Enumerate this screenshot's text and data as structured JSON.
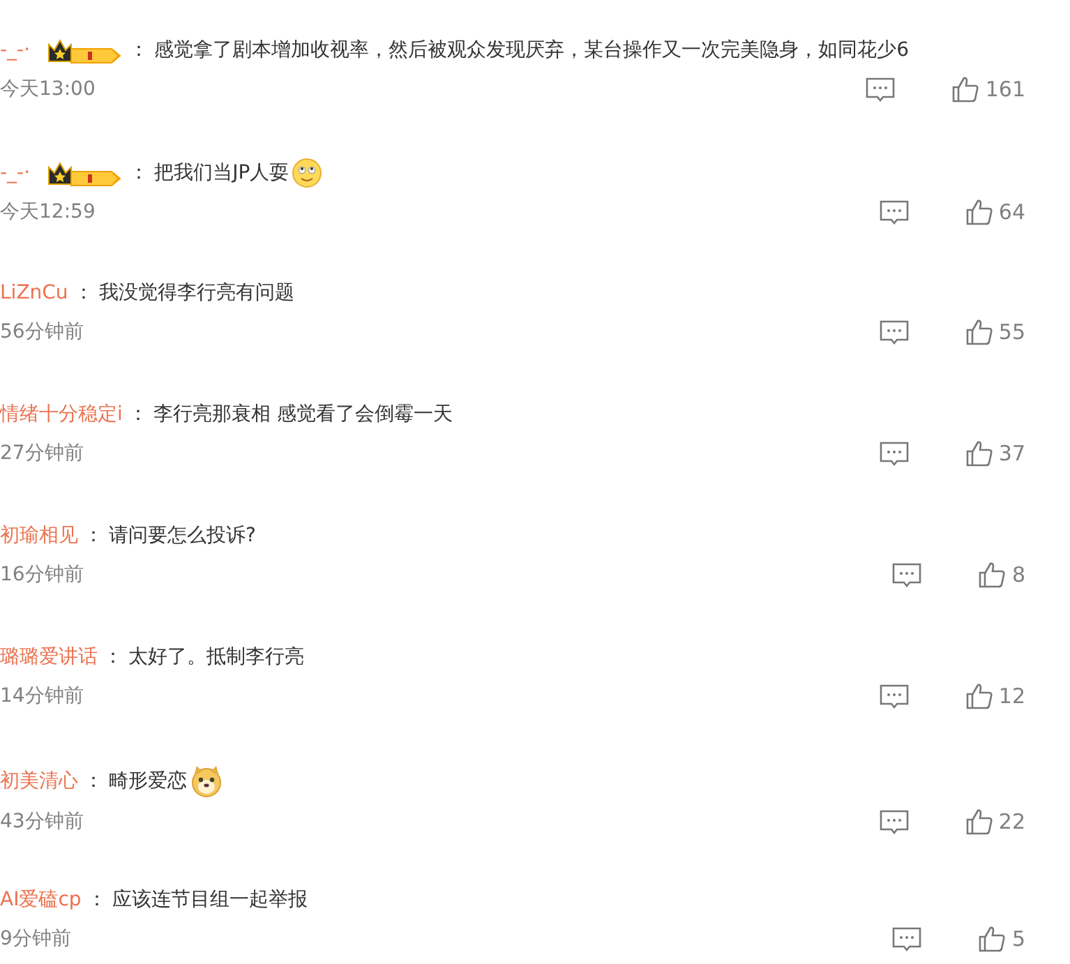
{
  "comments": [
    {
      "user": "-_-·",
      "vip_badge": true,
      "separator": "：",
      "text": "感觉拿了剧本增加收视率，然后被观众发现厌弃，某台操作又一次完美隐身，如同花少6",
      "time": "今天13:00",
      "likes": "161"
    },
    {
      "user": "-_-·",
      "vip_badge": true,
      "separator": "：",
      "text": "把我们当JP人耍",
      "emoji": {
        "kind": "face"
      },
      "time": "今天12:59",
      "likes": "64"
    },
    {
      "user": "LiZnCu",
      "vip_badge": false,
      "separator": "：",
      "text": "我没觉得李行亮有问题",
      "time": "56分钟前",
      "likes": "55"
    },
    {
      "user": "情绪十分稳定i",
      "vip_badge": false,
      "separator": "：",
      "text": "李行亮那衰相 感觉看了会倒霉一天",
      "time": "27分钟前",
      "likes": "37"
    },
    {
      "user": "初瑜相见",
      "vip_badge": false,
      "separator": "：",
      "text": "请问要怎么投诉?",
      "time": "16分钟前",
      "likes": "8"
    },
    {
      "user": "璐璐爱讲话",
      "vip_badge": false,
      "separator": "：",
      "text": "太好了。抵制李行亮",
      "time": "14分钟前",
      "likes": "12"
    },
    {
      "user": "初美清心",
      "vip_badge": false,
      "separator": "：",
      "text": "畸形爱恋",
      "emoji": {
        "kind": "dog"
      },
      "time": "43分钟前",
      "likes": "22"
    },
    {
      "user": "AI爱磕cp",
      "vip_badge": false,
      "separator": "：",
      "text": "应该连节目组一起举报",
      "time": "9分钟前",
      "likes": "5"
    }
  ]
}
